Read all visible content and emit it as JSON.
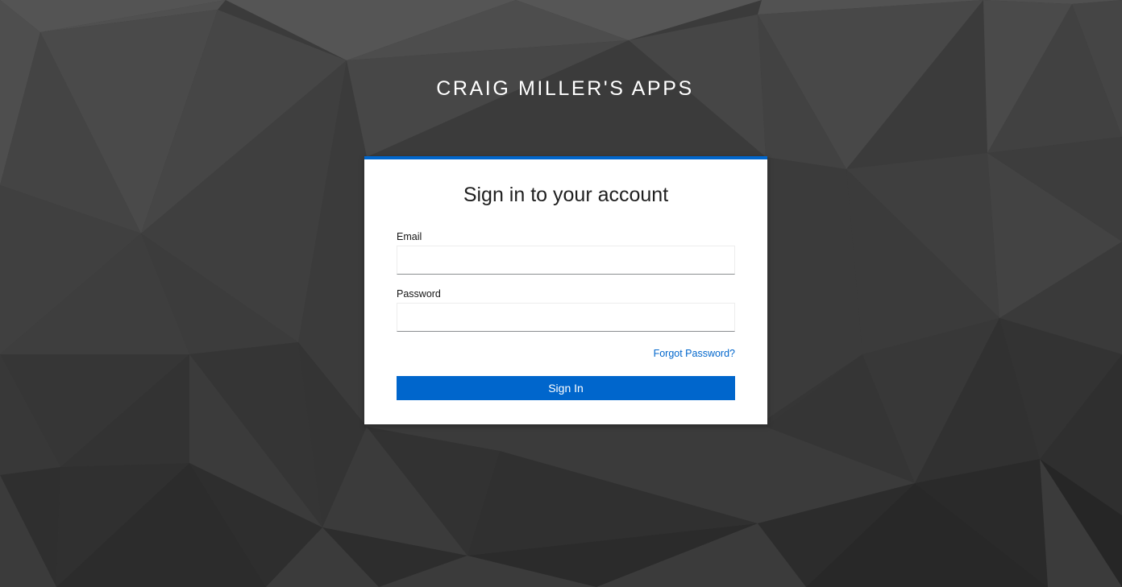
{
  "realm": {
    "title": "CRAIG MILLER'S APPS"
  },
  "login": {
    "heading": "Sign in to your account",
    "email_label": "Email",
    "email_value": "",
    "password_label": "Password",
    "password_value": "",
    "forgot_link": "Forgot Password?",
    "submit_label": "Sign In"
  },
  "colors": {
    "accent": "#0066cc",
    "background": "#3a3a3a",
    "card": "#ffffff"
  }
}
